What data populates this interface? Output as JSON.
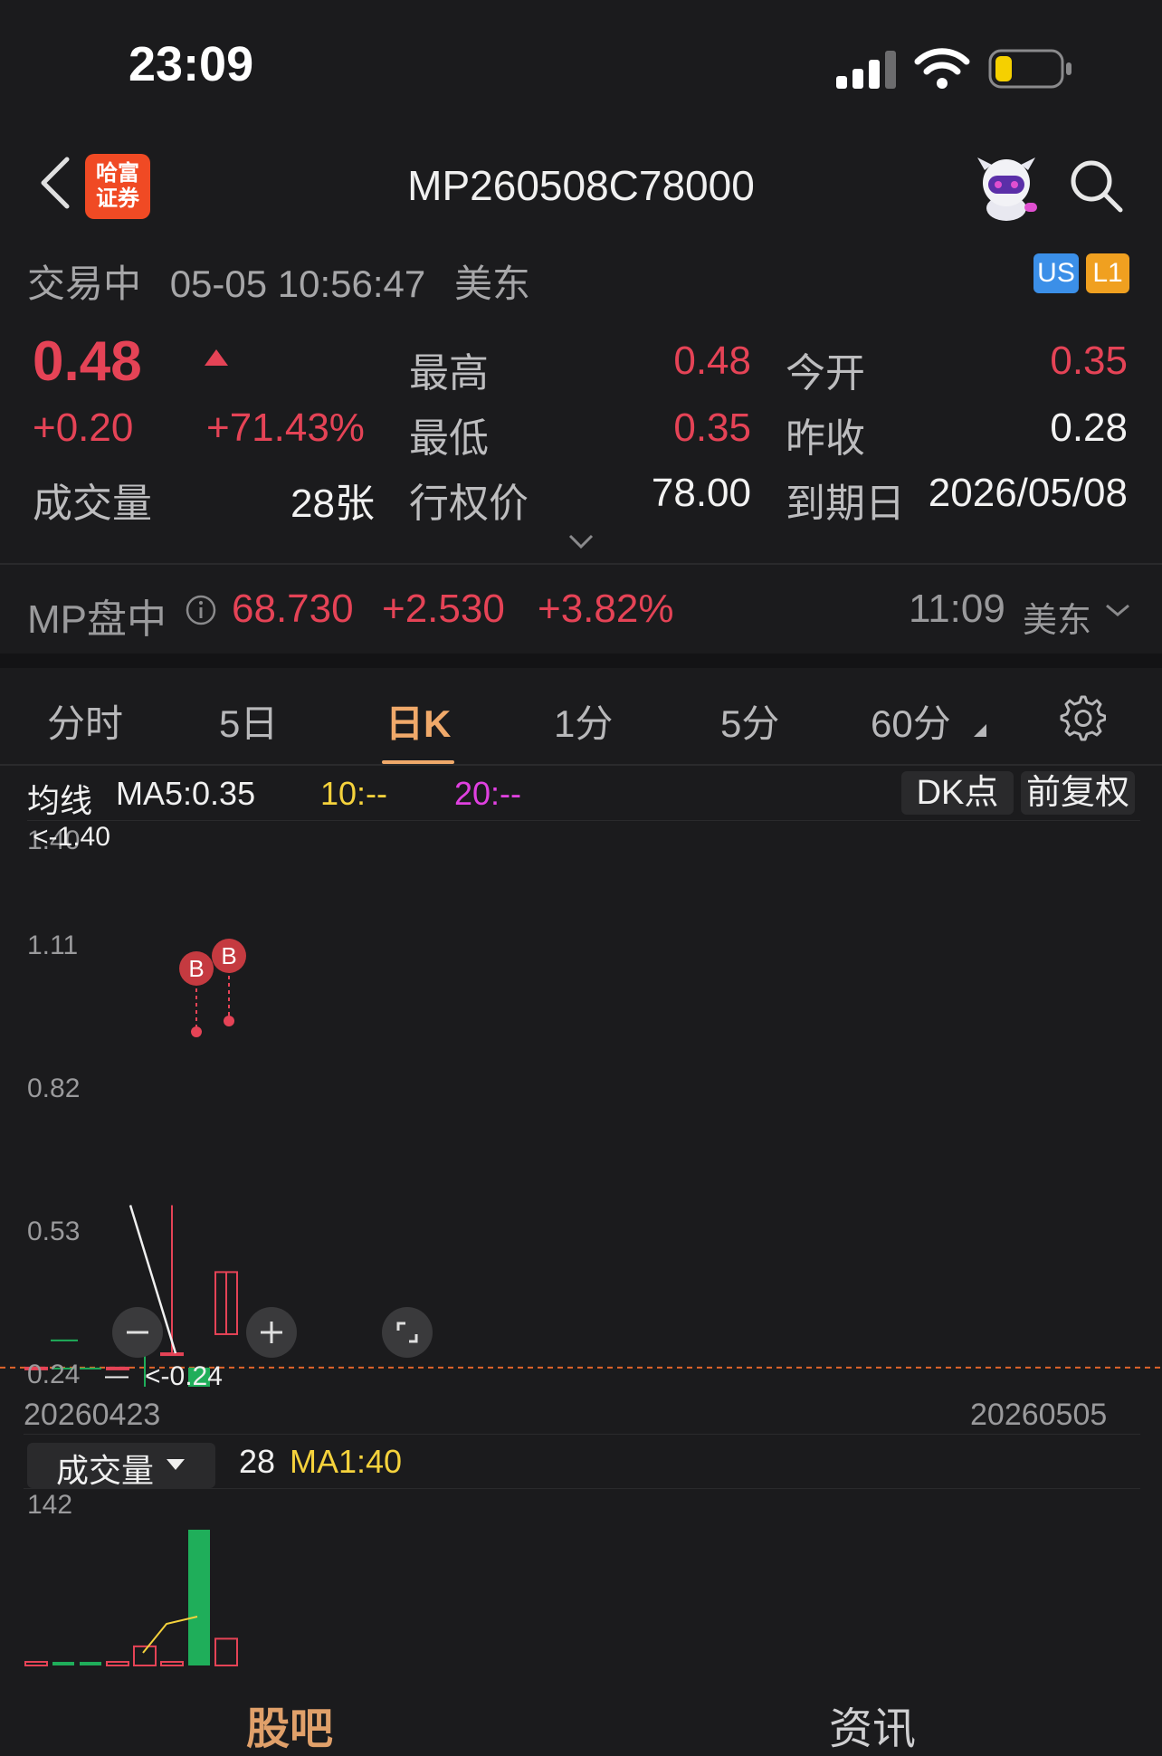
{
  "status_bar": {
    "time": "23:09"
  },
  "nav": {
    "logo_line1": "哈富",
    "logo_line2": "证券",
    "title": "MP260508C78000"
  },
  "trade_status": {
    "state": "交易中",
    "datetime": "05-05 10:56:47",
    "zone": "美东",
    "badge_market": "US",
    "badge_level": "L1"
  },
  "quote": {
    "price": "0.48",
    "change": "+0.20",
    "change_pct": "+71.43%",
    "high_label": "最高",
    "high": "0.48",
    "low_label": "最低",
    "low": "0.35",
    "open_label": "今开",
    "open": "0.35",
    "prev_close_label": "昨收",
    "prev_close": "0.28",
    "volume_label": "成交量",
    "volume": "28张",
    "strike_label": "行权价",
    "strike": "78.00",
    "expiry_label": "到期日",
    "expiry": "2026/05/08"
  },
  "underlying": {
    "name": "MP盘中",
    "price": "68.730",
    "change": "+2.530",
    "change_pct": "+3.82%",
    "time": "11:09",
    "zone": "美东"
  },
  "tabs": [
    "分时",
    "5日",
    "日K",
    "1分",
    "5分",
    "60分"
  ],
  "active_tab": "日K",
  "ma_line": {
    "label": "均线",
    "ma5": "MA5:0.35",
    "ma10": "10:--",
    "ma20": "20:--",
    "ma10_color": "#f5d23c",
    "ma20_color": "#e040e0"
  },
  "chart_buttons": {
    "dk": "DK点",
    "adjust": "前复权"
  },
  "chart_data": {
    "type": "candlestick",
    "y_ticks": [
      "1.40",
      "1.11",
      "0.82",
      "0.53",
      "0.24"
    ],
    "max_marker": "<-1.40",
    "min_marker": "<-0.24",
    "x_start": "20260423",
    "x_end": "20260505",
    "ylim": [
      0.24,
      1.4
    ],
    "candles": [
      {
        "open": 0.28,
        "close": 0.28,
        "high": 0.28,
        "low": 0.28,
        "color": "red"
      },
      {
        "open": 0.28,
        "close": 0.28,
        "high": 0.28,
        "low": 0.28,
        "color": "green"
      },
      {
        "open": 0.28,
        "close": 0.28,
        "high": 0.28,
        "low": 0.28,
        "color": "green"
      },
      {
        "open": 0.28,
        "close": 0.28,
        "high": 0.28,
        "low": 0.28,
        "color": "red"
      },
      {
        "open": 0.35,
        "close": 0.35,
        "high": 0.35,
        "low": 0.24,
        "color": "green"
      },
      {
        "open": 0.31,
        "close": 0.31,
        "high": 0.62,
        "low": 0.31,
        "color": "red"
      },
      {
        "open": 0.28,
        "close": 0.24,
        "high": 0.28,
        "low": 0.24,
        "color": "green"
      },
      {
        "open": 0.35,
        "close": 0.48,
        "high": 0.48,
        "low": 0.35,
        "color": "red"
      }
    ],
    "buy_markers": [
      "B",
      "B"
    ],
    "reference_line": 0.28
  },
  "volume_panel": {
    "label": "成交量",
    "value": "28",
    "ma": "MA1:40",
    "ma_color": "#f5d23c",
    "axis_max": "142",
    "values": [
      0,
      0,
      0,
      0,
      20,
      0,
      142,
      28
    ]
  },
  "bottom_tabs": {
    "left": "股吧",
    "right": "资讯"
  }
}
